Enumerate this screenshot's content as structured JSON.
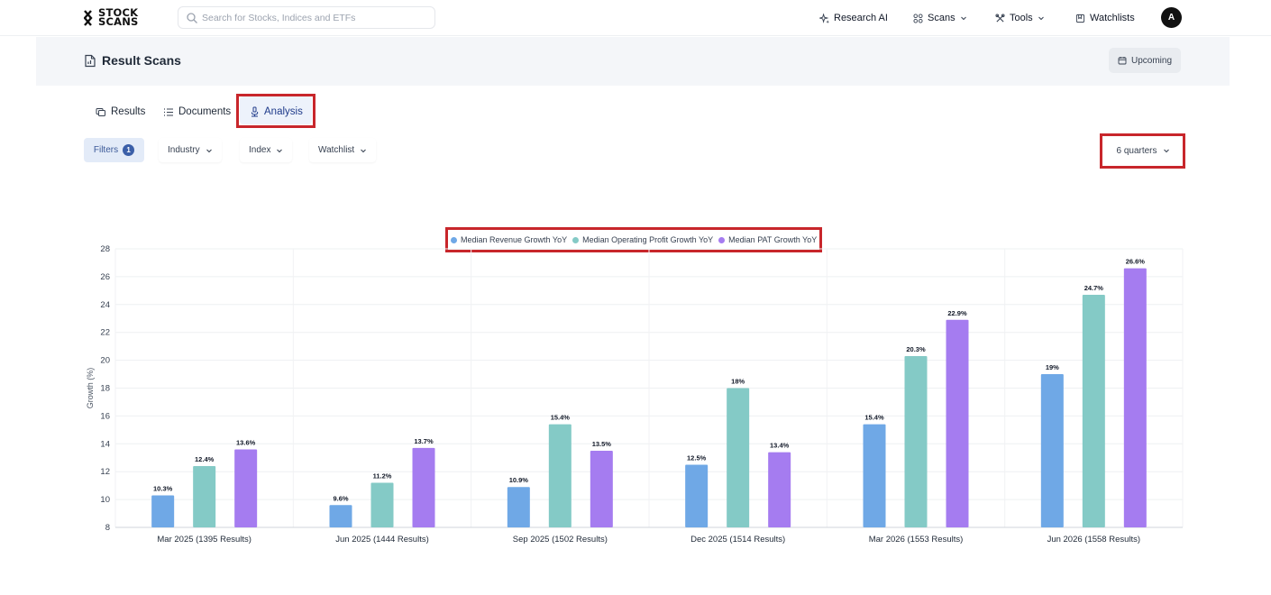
{
  "brand": {
    "line1": "STOCK",
    "line2": "SCANS"
  },
  "search": {
    "placeholder": "Search for Stocks, Indices and ETFs"
  },
  "nav": {
    "research_ai": "Research AI",
    "scans": "Scans",
    "tools": "Tools",
    "watchlists": "Watchlists",
    "avatar_initial": "A"
  },
  "header": {
    "title": "Result Scans",
    "upcoming": "Upcoming"
  },
  "tabs": [
    {
      "label": "Results"
    },
    {
      "label": "Documents"
    },
    {
      "label": "Analysis",
      "active": true
    }
  ],
  "filters": {
    "filters_label": "Filters",
    "filters_count": "1",
    "industry": "Industry",
    "index": "Index",
    "watchlist": "Watchlist",
    "quarters": "6 quarters"
  },
  "colors": {
    "revenue": "#6fa8e6",
    "operating": "#84cac6",
    "pat": "#a57cf0",
    "highlight": "#c8262b"
  },
  "chart_data": {
    "type": "bar",
    "ylabel": "Growth (%)",
    "ylim": [
      8,
      28
    ],
    "yticks": [
      8,
      10,
      12,
      14,
      16,
      18,
      20,
      22,
      24,
      26,
      28
    ],
    "grid": true,
    "legend_position": "top-center",
    "categories": [
      "Mar 2025 (1395 Results)",
      "Jun 2025 (1444 Results)",
      "Sep 2025 (1502 Results)",
      "Dec 2025 (1514 Results)",
      "Mar 2026 (1553 Results)",
      "Jun 2026 (1558 Results)"
    ],
    "series": [
      {
        "name": "Median Revenue Growth YoY",
        "values": [
          10.3,
          9.6,
          10.9,
          12.5,
          15.4,
          19
        ],
        "labels": [
          "10.3%",
          "9.6%",
          "10.9%",
          "12.5%",
          "15.4%",
          "19%"
        ]
      },
      {
        "name": "Median Operating Profit Growth YoY",
        "values": [
          12.4,
          11.2,
          15.4,
          18,
          20.3,
          24.7
        ],
        "labels": [
          "12.4%",
          "11.2%",
          "15.4%",
          "18%",
          "20.3%",
          "24.7%"
        ]
      },
      {
        "name": "Median PAT Growth YoY",
        "values": [
          13.6,
          13.7,
          13.5,
          13.4,
          22.9,
          26.6
        ],
        "labels": [
          "13.6%",
          "13.7%",
          "13.5%",
          "13.4%",
          "22.9%",
          "26.6%"
        ]
      }
    ]
  }
}
